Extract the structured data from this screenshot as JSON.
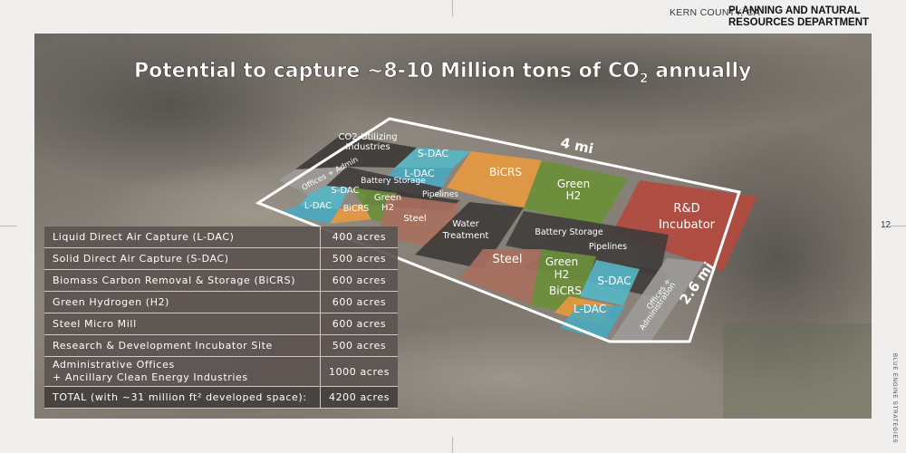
{
  "header": {
    "county": "KERN COUNTY, CA",
    "dept_line1": "PLANNING AND NATURAL",
    "dept_line2": "RESOURCES DEPARTMENT"
  },
  "page_number": "12",
  "side_credit": "BLUE ENGINE STRATEGIES",
  "title": {
    "main": "Potential to capture ~8-10 Million tons of CO",
    "sub": "2",
    "tail": " annually"
  },
  "map": {
    "dim_width": "4 mi",
    "dim_depth": "2.6 mi",
    "zones": {
      "co2_utilizing": [
        "CO2-Utilizing",
        "Industries"
      ],
      "offices_admin": "Offices + Admin",
      "s_dac_top": "S-DAC",
      "l_dac_top": "L-DAC",
      "bicrs_top": "BiCRS",
      "green_h2_top": [
        "Green",
        "H2"
      ],
      "rd_incubator": [
        "R&D",
        "Incubator"
      ],
      "battery_storage_1": "Battery Storage",
      "pipelines_1": "Pipelines",
      "s_dac_left": "S-DAC",
      "l_dac_left": "L-DAC",
      "bicrs_left": "BiCRS",
      "green_h2_left": [
        "Green",
        "H2"
      ],
      "steel_left": "Steel",
      "water_treatment": [
        "Water",
        "Treatment"
      ],
      "battery_storage_2": "Battery Storage",
      "pipelines_2": "Pipelines",
      "steel_mid": "Steel",
      "green_h2_mid": [
        "Green",
        "H2"
      ],
      "bicrs_mid": "BiCRS",
      "s_dac_mid": "S-DAC",
      "l_dac_mid": "L-DAC",
      "offices_admin_2": [
        "Offices +",
        "Administration"
      ]
    }
  },
  "table": {
    "rows": [
      {
        "label": "Liquid Direct Air Capture (L-DAC)",
        "value": "400 acres"
      },
      {
        "label": "Solid Direct Air Capture (S-DAC)",
        "value": "500 acres"
      },
      {
        "label": "Biomass Carbon Removal & Storage (BiCRS)",
        "value": "600 acres"
      },
      {
        "label": "Green Hydrogen (H2)",
        "value": "600 acres"
      },
      {
        "label": "Steel Micro Mill",
        "value": "600 acres"
      },
      {
        "label": "Research & Development Incubator Site",
        "value": "500 acres"
      },
      {
        "label_line1": "Administrative Offices",
        "label_line2": "+ Ancillary Clean Energy Industries",
        "value": "1000 acres"
      },
      {
        "label": "TOTAL (with ~31 million ft² developed space):",
        "value": "4200 acres"
      }
    ]
  },
  "colors": {
    "s_dac": "#57b7c6",
    "l_dac": "#4aa9bf",
    "bicrs": "#e7993f",
    "green_h2": "#6b8f3a",
    "rd": "#b34a3f",
    "dark": "#3f3c3b",
    "steel": "#a86f5e",
    "offices": "#9c9a98"
  }
}
